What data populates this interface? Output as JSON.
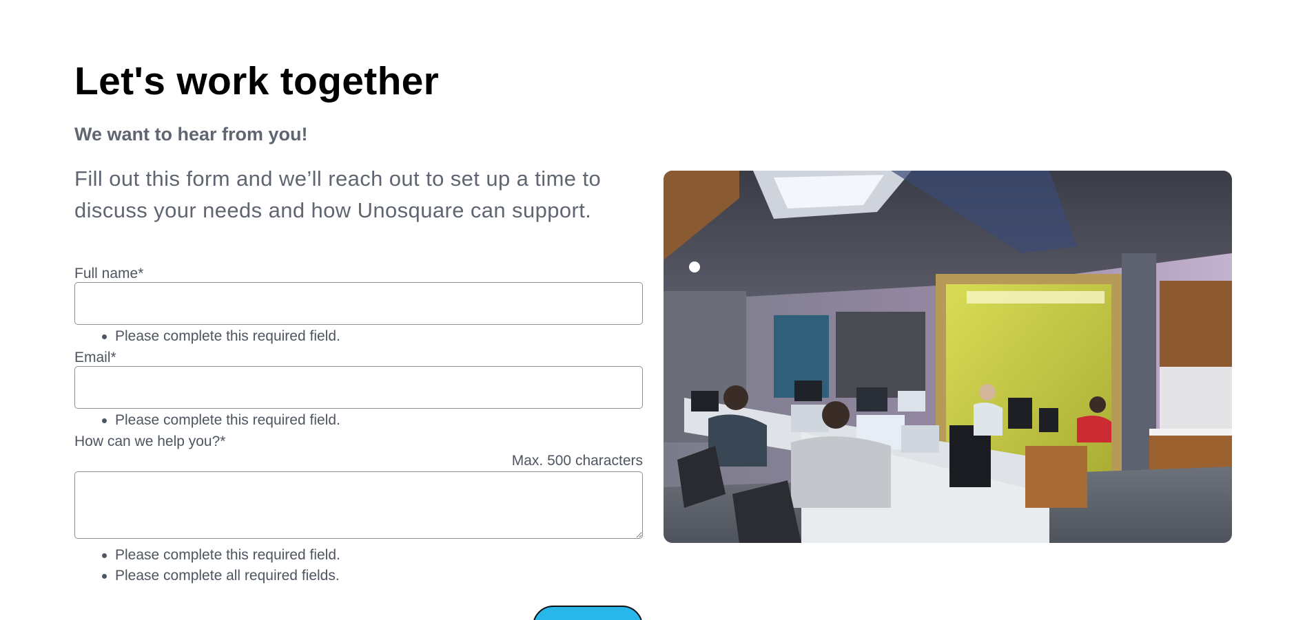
{
  "page": {
    "title": "Let's work together",
    "subtitle": "We want to hear from you!",
    "intro": "Fill out this form and we’ll reach out to set up a time to discuss your needs and how Unosquare can support."
  },
  "form": {
    "full_name": {
      "label": "Full name*",
      "value": "",
      "error": "Please complete this required field."
    },
    "email": {
      "label": "Email*",
      "value": "",
      "error": "Please complete this required field."
    },
    "message": {
      "label": "How can we help you?*",
      "hint": "Max. 500 characters",
      "value": "",
      "error": "Please complete this required field.",
      "form_error": "Please complete all required fields."
    },
    "submit": {
      "label": ""
    }
  },
  "photo": {
    "subject": "office workspace with people at computers and a yellow phone booth"
  },
  "colors": {
    "heading": "#000000",
    "text_muted": "#5f6671",
    "field_border": "#8a8f96",
    "submit_bg": "#29b6e8"
  }
}
